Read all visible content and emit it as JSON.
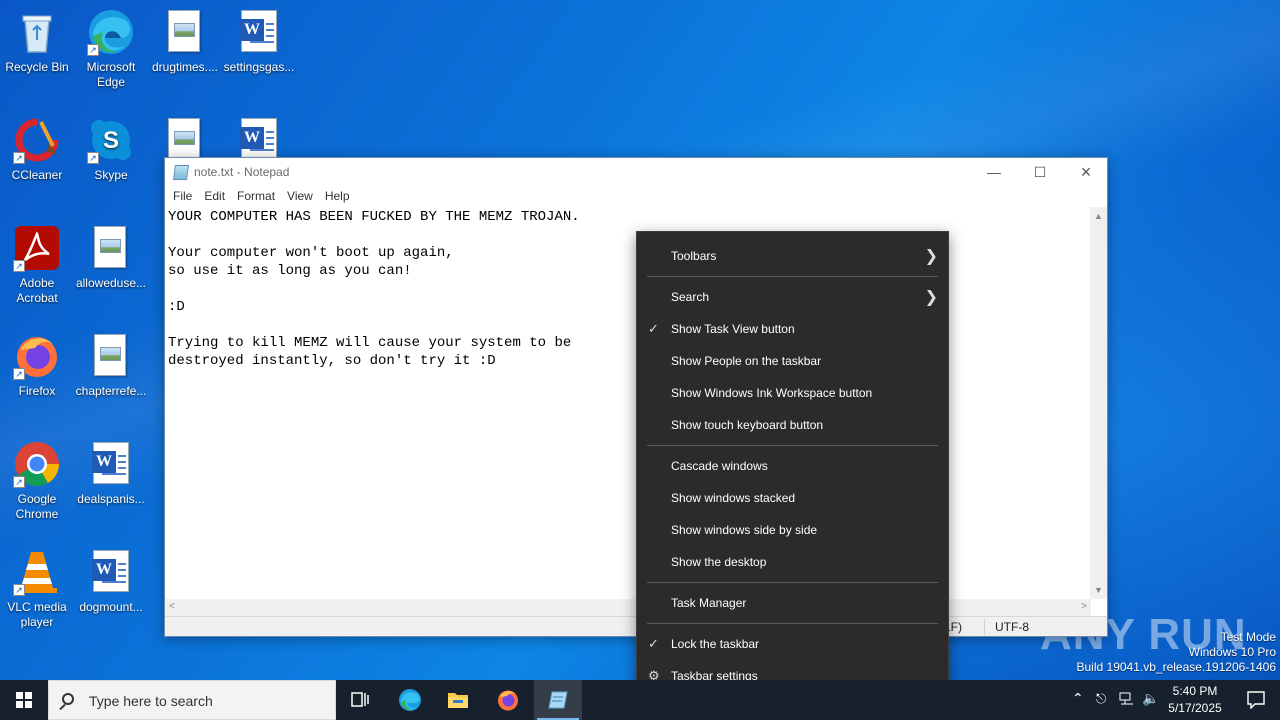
{
  "desktop": {
    "icons": [
      {
        "label": "Recycle Bin"
      },
      {
        "label": "Microsoft Edge"
      },
      {
        "label": "drugtimes...."
      },
      {
        "label": "settingsgas..."
      },
      {
        "label": "CCleaner"
      },
      {
        "label": "Skype"
      },
      {
        "label": "Adobe Acrobat"
      },
      {
        "label": "alloweduse..."
      },
      {
        "label": "Firefox"
      },
      {
        "label": "chapterrefe..."
      },
      {
        "label": "Google Chrome"
      },
      {
        "label": "dealspanis..."
      },
      {
        "label": "VLC media player"
      },
      {
        "label": "dogmount..."
      }
    ]
  },
  "notepad": {
    "title": "note.txt - Notepad",
    "menu": [
      "File",
      "Edit",
      "Format",
      "View",
      "Help"
    ],
    "content": "YOUR COMPUTER HAS BEEN FUCKED BY THE MEMZ TROJAN.\n\nYour computer won't boot up again,\nso use it as long as you can!\n\n:D\n\nTrying to kill MEMZ will cause your system to be\ndestroyed instantly, so don't try it :D",
    "status": {
      "line_ending": "LF)",
      "encoding": "UTF-8"
    }
  },
  "context_menu": {
    "items": [
      {
        "label": "Toolbars",
        "submenu": true
      },
      {
        "label": "Search",
        "submenu": true
      },
      {
        "label": "Show Task View button",
        "checked": true
      },
      {
        "label": "Show People on the taskbar"
      },
      {
        "label": "Show Windows Ink Workspace button"
      },
      {
        "label": "Show touch keyboard button"
      },
      {
        "label": "Cascade windows"
      },
      {
        "label": "Show windows stacked"
      },
      {
        "label": "Show windows side by side"
      },
      {
        "label": "Show the desktop"
      },
      {
        "label": "Task Manager"
      },
      {
        "label": "Lock the taskbar",
        "checked": true
      },
      {
        "label": "Taskbar settings",
        "icon": "gear-icon"
      }
    ]
  },
  "taskbar": {
    "search_placeholder": "Type here to search",
    "time": "5:40 PM",
    "date": "5/17/2025"
  },
  "system_info": {
    "line1": "Test Mode",
    "line2": "Windows 10 Pro",
    "line3": "Build 19041.vb_release.191206-1406"
  },
  "watermark": "ANY RUN"
}
